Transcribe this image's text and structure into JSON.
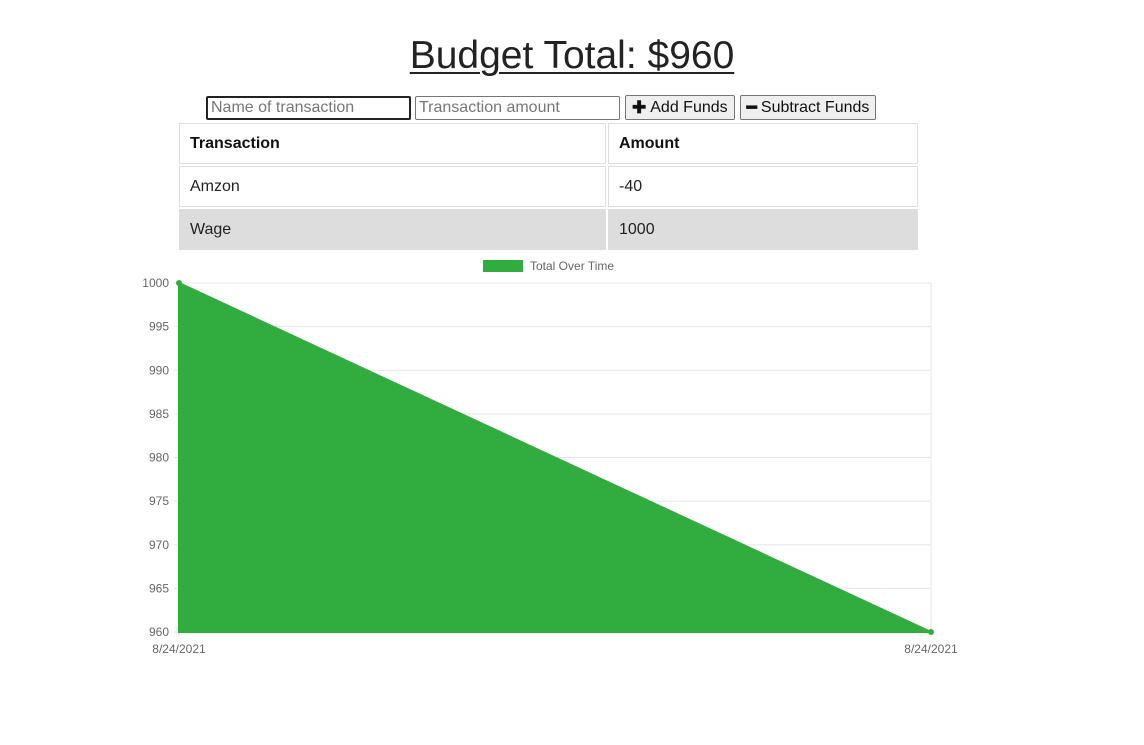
{
  "header": {
    "title": "Budget Total: $960"
  },
  "form": {
    "name_placeholder": "Name of transaction",
    "amount_placeholder": "Transaction amount",
    "add_label": "Add Funds",
    "subtract_label": "Subtract Funds",
    "add_icon": "plus-icon",
    "subtract_icon": "minus-icon"
  },
  "table": {
    "headers": [
      "Transaction",
      "Amount"
    ],
    "rows": [
      {
        "name": "Amzon",
        "amount": "-40"
      },
      {
        "name": "Wage",
        "amount": "1000"
      }
    ]
  },
  "colors": {
    "series_fill": "#31ad3f",
    "series_line": "#31ad3f",
    "grid": "#e6e6e6",
    "row_alt": "#dddddd"
  },
  "chart_data": {
    "type": "area",
    "title": "",
    "xlabel": "",
    "ylabel": "",
    "categories": [
      "8/24/2021",
      "8/24/2021"
    ],
    "series": [
      {
        "name": "Total Over Time",
        "values": [
          1000,
          960
        ]
      }
    ],
    "ylim": [
      960,
      1000
    ],
    "y_ticks": [
      1000,
      995,
      990,
      985,
      980,
      975,
      970,
      965,
      960
    ],
    "grid": true,
    "legend_position": "top"
  }
}
